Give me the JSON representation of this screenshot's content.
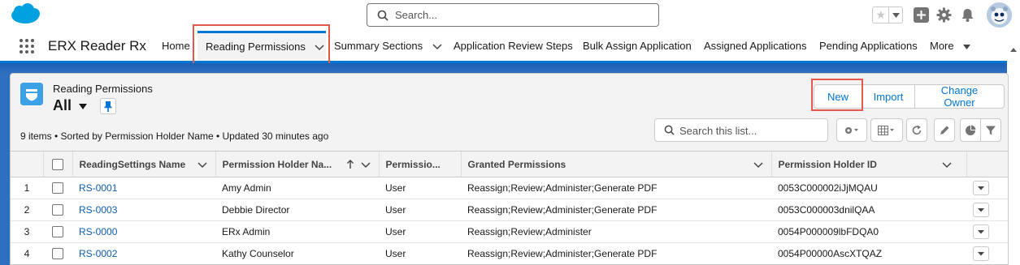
{
  "global_header": {
    "search_placeholder": "Search..."
  },
  "app_nav": {
    "app_name": "ERX Reader Rx",
    "items": [
      {
        "label": "Home"
      },
      {
        "label": "Reading Permissions"
      },
      {
        "label": "Summary Sections"
      },
      {
        "label": "Application Review Steps"
      },
      {
        "label": "Bulk Assign Application"
      },
      {
        "label": "Assigned Applications"
      },
      {
        "label": "Pending Applications"
      },
      {
        "label": "More"
      }
    ]
  },
  "list_view": {
    "object_label": "Reading Permissions",
    "view_name": "All",
    "buttons": {
      "new": "New",
      "import": "Import",
      "change_owner": "Change Owner"
    },
    "summary": "9 items • Sorted by Permission Holder Name • Updated 30 minutes ago",
    "search_placeholder": "Search this list...",
    "columns": [
      "ReadingSettings Name",
      "Permission Holder Na...",
      "Permissio...",
      "Granted Permissions",
      "Permission Holder ID"
    ],
    "rows": [
      {
        "num": "1",
        "name": "RS-0001",
        "holder": "Amy Admin",
        "perm_type": "User",
        "granted": "Reassign;Review;Administer;Generate PDF",
        "holder_id": "0053C000002iJjMQAU"
      },
      {
        "num": "2",
        "name": "RS-0003",
        "holder": "Debbie Director",
        "perm_type": "User",
        "granted": "Reassign;Review;Administer;Generate PDF",
        "holder_id": "0053C000003dnilQAA"
      },
      {
        "num": "3",
        "name": "RS-0000",
        "holder": "ERx Admin",
        "perm_type": "User",
        "granted": "Reassign;Review;Administer",
        "holder_id": "0054P000009lbFDQA0"
      },
      {
        "num": "4",
        "name": "RS-0002",
        "holder": "Kathy Counselor",
        "perm_type": "User",
        "granted": "Reassign;Review;Administer;Generate PDF",
        "holder_id": "0054P00000AscXTQAZ"
      }
    ]
  },
  "colors": {
    "brand_blue": "#0176d3",
    "cloud_blue": "#00a1e0",
    "band_blue": "#2e6fbf",
    "object_icon": "#3ba0e6",
    "highlight_red": "#e5574b"
  }
}
